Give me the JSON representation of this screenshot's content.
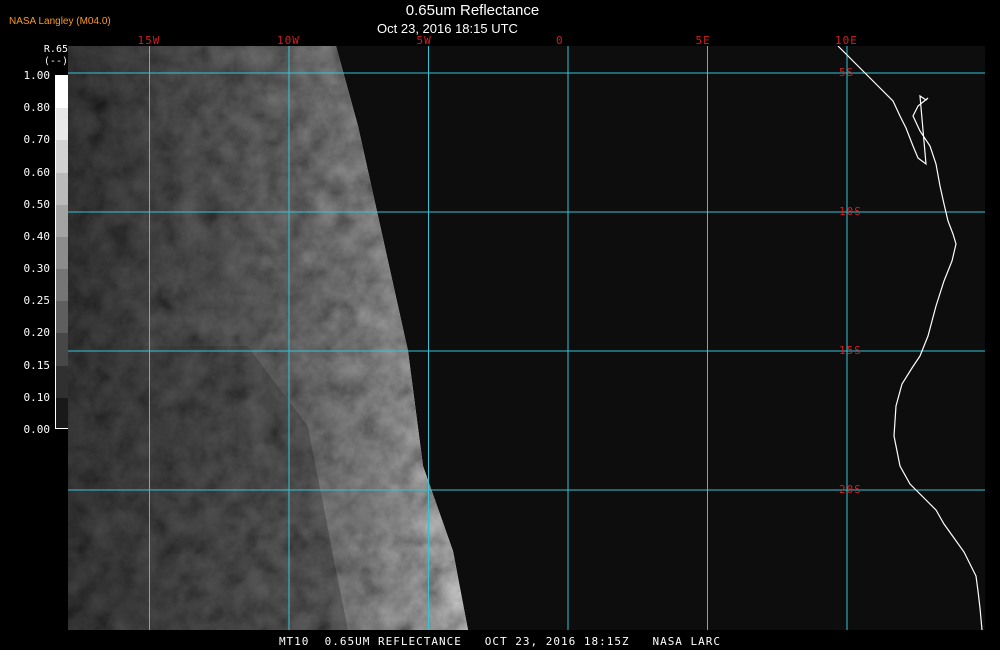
{
  "credit": "NASA Langley (M04.0)",
  "title": "0.65um Reflectance",
  "subtitle": "Oct 23, 2016 18:15 UTC",
  "legend": {
    "variable": "R.65",
    "units": "(--)",
    "tick_labels": [
      "1.00",
      "0.80",
      "0.70",
      "0.60",
      "0.50",
      "0.40",
      "0.30",
      "0.25",
      "0.20",
      "0.15",
      "0.10",
      "0.00"
    ],
    "ticks": [
      1.0,
      0.8,
      0.7,
      0.6,
      0.5,
      0.4,
      0.3,
      0.25,
      0.2,
      0.15,
      0.1,
      0.0
    ]
  },
  "grid": {
    "longitudes": [
      {
        "value": -15,
        "label": "15W"
      },
      {
        "value": -10,
        "label": "10W"
      },
      {
        "value": -5,
        "label": "5W"
      },
      {
        "value": 0,
        "label": "0"
      },
      {
        "value": 5,
        "label": "5E"
      },
      {
        "value": 10,
        "label": "10E"
      }
    ],
    "latitudes": [
      {
        "value": -5,
        "label": "5S"
      },
      {
        "value": -10,
        "label": "10S"
      },
      {
        "value": -15,
        "label": "15S"
      },
      {
        "value": -20,
        "label": "20S"
      }
    ],
    "color": "#33c4d8"
  },
  "colors": {
    "grid": "#33c4d8",
    "labels": "#d21f1f",
    "credit": "#ff9a1a",
    "coastline": "#ffffff"
  },
  "footer": "MT10  0.65UM REFLECTANCE   OCT 23, 2016 18:15Z   NASA LARC"
}
